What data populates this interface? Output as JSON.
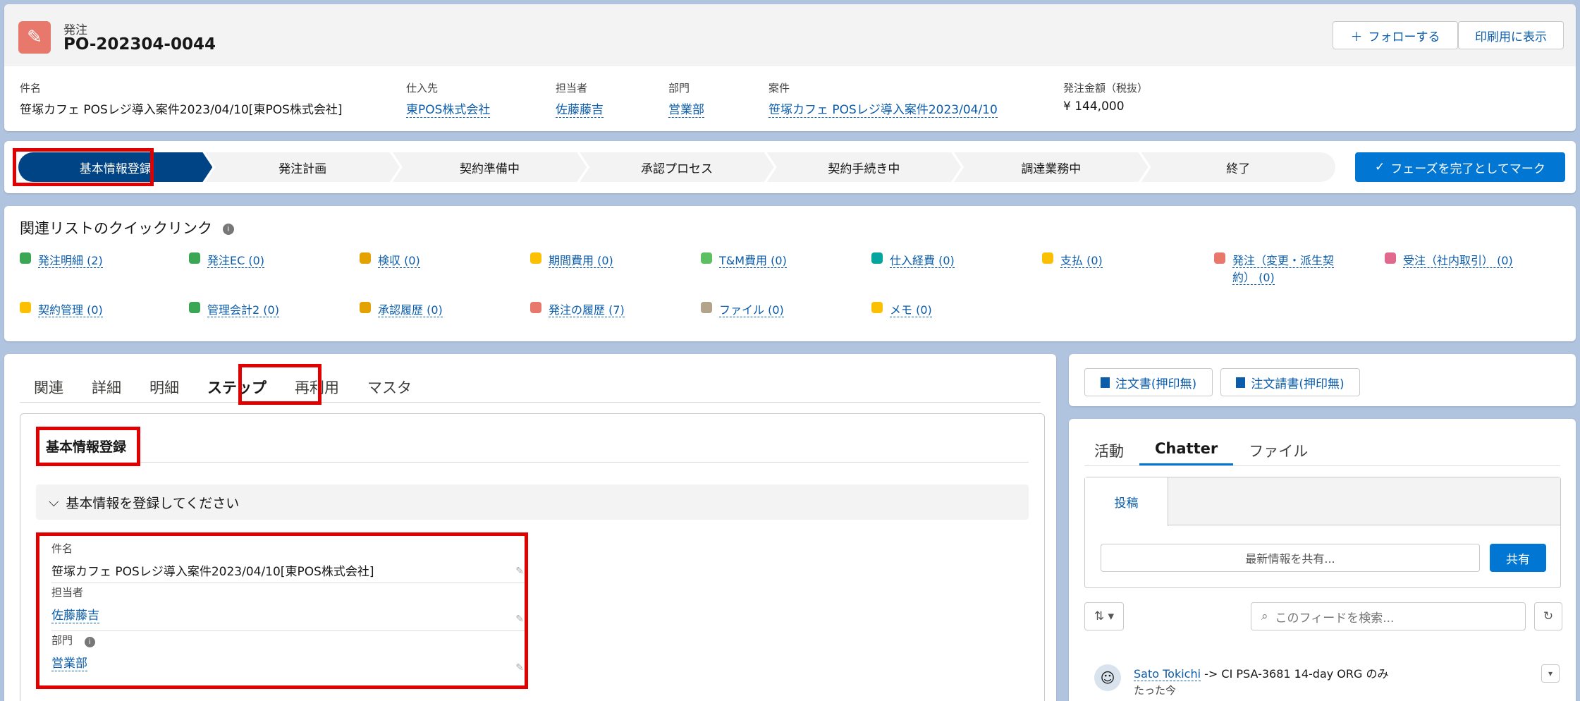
{
  "header": {
    "object_type": "発注",
    "record_name": "PO-202304-0044",
    "follow_label": "フォローする",
    "print_label": "印刷用に表示",
    "fields": [
      {
        "label": "件名",
        "value": "笹塚カフェ POSレジ導入案件2023/04/10[東POS株式会社]",
        "link": false
      },
      {
        "label": "仕入先",
        "value": "東POS株式会社",
        "link": true
      },
      {
        "label": "担当者",
        "value": "佐藤藤吉",
        "link": true
      },
      {
        "label": "部門",
        "value": "営業部",
        "link": true
      },
      {
        "label": "案件",
        "value": "笹塚カフェ POSレジ導入案件2023/04/10",
        "link": true
      },
      {
        "label": "発注金額（税抜）",
        "value": "¥ 144,000",
        "link": false
      }
    ]
  },
  "path": {
    "steps": [
      "基本情報登録",
      "発注計画",
      "契約準備中",
      "承認プロセス",
      "契約手続き中",
      "調達業務中",
      "終了"
    ],
    "active_index": 0,
    "mark_complete_label": "フェーズを完了としてマーク"
  },
  "quick_links": {
    "title": "関連リストのクイックリンク",
    "items": [
      {
        "label": "発注明細 (2)",
        "color": "#3ba755"
      },
      {
        "label": "発注EC (0)",
        "color": "#3ba755"
      },
      {
        "label": "検収 (0)",
        "color": "#e4a201"
      },
      {
        "label": "期間費用 (0)",
        "color": "#fcc003"
      },
      {
        "label": "T&M費用 (0)",
        "color": "#5cbf62"
      },
      {
        "label": "仕入経費 (0)",
        "color": "#04a59f"
      },
      {
        "label": "支払 (0)",
        "color": "#fcc003"
      },
      {
        "label": "発注（変更・派生契",
        "label2": "約） (0)",
        "color": "#e8776c"
      },
      {
        "label": "受注（社内取引） (0)",
        "color": "#e06a8e"
      },
      {
        "label": "契約管理 (0)",
        "color": "#fcc003"
      },
      {
        "label": "管理会計2 (0)",
        "color": "#3ba755"
      },
      {
        "label": "承認履歴 (0)",
        "color": "#e4a201"
      },
      {
        "label": "発注の履歴 (7)",
        "color": "#e8776c"
      },
      {
        "label": "ファイル (0)",
        "color": "#b3a38a"
      },
      {
        "label": "メモ (0)",
        "color": "#fcc003"
      }
    ]
  },
  "main": {
    "tabs": [
      "関連",
      "詳細",
      "明細",
      "ステップ",
      "再利用",
      "マスタ"
    ],
    "active_tab": 3,
    "section_title": "基本情報登録",
    "subsection_title": "基本情報を登録してください",
    "fields": [
      {
        "label": "件名",
        "value": "笹塚カフェ POSレジ導入案件2023/04/10[東POS株式会社]",
        "link": false
      },
      {
        "label": "担当者",
        "value": "佐藤藤吉",
        "link": true
      },
      {
        "label": "部門",
        "value": "営業部",
        "link": true
      }
    ]
  },
  "right": {
    "btn1": "注文書(押印無)",
    "btn2": "注文請書(押印無)",
    "tabs": [
      "活動",
      "Chatter",
      "ファイル"
    ],
    "active_tab": 1,
    "post_tab": "投稿",
    "share_placeholder": "最新情報を共有...",
    "share_label": "共有",
    "search_placeholder": "このフィードを検索...",
    "feed_user": "Sato Tokichi",
    "feed_text": " -> CI PSA-3681 14-day ORG のみ",
    "feed_time": "たった今"
  }
}
